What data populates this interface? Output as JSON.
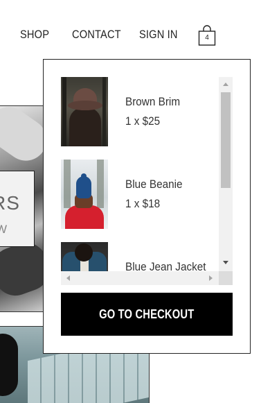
{
  "nav": {
    "shop": "SHOP",
    "contact": "CONTACT",
    "sign_in": "SIGN IN",
    "cart_icon": "shopping-bag-icon",
    "cart_count": "4"
  },
  "background": {
    "hero_text_big": "RS",
    "hero_text_small": "W"
  },
  "cart": {
    "items": [
      {
        "name": "Brown Brim",
        "price": "1 x $25"
      },
      {
        "name": "Blue Beanie",
        "price": "1 x $18"
      },
      {
        "name": "Blue Jean Jacket",
        "price": ""
      }
    ],
    "checkout_label": "GO TO CHECKOUT"
  },
  "colors": {
    "checkout_bg": "#000000",
    "checkout_text": "#ffffff",
    "border": "#222222"
  }
}
